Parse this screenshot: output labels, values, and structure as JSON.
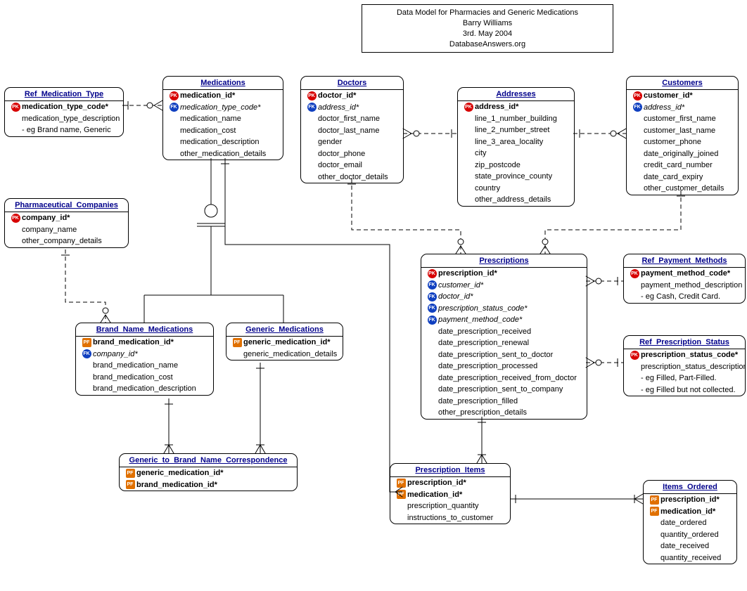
{
  "title": {
    "line1": "Data Model for Pharmacies and Generic Medications",
    "line2": "Barry Williams",
    "line3": "3rd. May 2004",
    "line4": "DatabaseAnswers.org"
  },
  "entities": {
    "ref_medication_type": {
      "name": "Ref_Medication_Type",
      "rows": [
        {
          "k": "pk",
          "t": "medication_type_code*",
          "cls": "attr-pk"
        },
        {
          "k": "",
          "t": "medication_type_description"
        },
        {
          "k": "",
          "t": "- eg Brand name, Generic"
        }
      ]
    },
    "medications": {
      "name": "Medications",
      "rows": [
        {
          "k": "pk",
          "t": "medication_id*",
          "cls": "attr-pk"
        },
        {
          "k": "fk",
          "t": "medication_type_code*",
          "cls": "attr-fk"
        },
        {
          "k": "",
          "t": "medication_name"
        },
        {
          "k": "",
          "t": "medication_cost"
        },
        {
          "k": "",
          "t": "medication_description"
        },
        {
          "k": "",
          "t": "other_medication_details"
        }
      ]
    },
    "doctors": {
      "name": "Doctors",
      "rows": [
        {
          "k": "pk",
          "t": "doctor_id*",
          "cls": "attr-pk"
        },
        {
          "k": "fk",
          "t": "address_id*",
          "cls": "attr-fk"
        },
        {
          "k": "",
          "t": "doctor_first_name"
        },
        {
          "k": "",
          "t": "doctor_last_name"
        },
        {
          "k": "",
          "t": "gender"
        },
        {
          "k": "",
          "t": "doctor_phone"
        },
        {
          "k": "",
          "t": "doctor_email"
        },
        {
          "k": "",
          "t": "other_doctor_details"
        }
      ]
    },
    "addresses": {
      "name": "Addresses",
      "rows": [
        {
          "k": "pk",
          "t": "address_id*",
          "cls": "attr-pk"
        },
        {
          "k": "",
          "t": "line_1_number_building"
        },
        {
          "k": "",
          "t": "line_2_number_street"
        },
        {
          "k": "",
          "t": "line_3_area_locality"
        },
        {
          "k": "",
          "t": "city"
        },
        {
          "k": "",
          "t": "zip_postcode"
        },
        {
          "k": "",
          "t": "state_province_county"
        },
        {
          "k": "",
          "t": "country"
        },
        {
          "k": "",
          "t": "other_address_details"
        }
      ]
    },
    "customers": {
      "name": "Customers",
      "rows": [
        {
          "k": "pk",
          "t": "customer_id*",
          "cls": "attr-pk"
        },
        {
          "k": "fk",
          "t": "address_id*",
          "cls": "attr-fk"
        },
        {
          "k": "",
          "t": "customer_first_name"
        },
        {
          "k": "",
          "t": "customer_last_name"
        },
        {
          "k": "",
          "t": "customer_phone"
        },
        {
          "k": "",
          "t": "date_originally_joined"
        },
        {
          "k": "",
          "t": "credit_card_number"
        },
        {
          "k": "",
          "t": "date_card_expiry"
        },
        {
          "k": "",
          "t": "other_customer_details"
        }
      ]
    },
    "pharma_companies": {
      "name": "Pharmaceutical_Companies",
      "rows": [
        {
          "k": "pk",
          "t": "company_id*",
          "cls": "attr-pk"
        },
        {
          "k": "",
          "t": "company_name"
        },
        {
          "k": "",
          "t": "other_company_details"
        }
      ]
    },
    "prescriptions": {
      "name": "Prescriptions",
      "rows": [
        {
          "k": "pk",
          "t": "prescription_id*",
          "cls": "attr-pk"
        },
        {
          "k": "fk",
          "t": "customer_id*",
          "cls": "attr-fk"
        },
        {
          "k": "fk",
          "t": "doctor_id*",
          "cls": "attr-fk"
        },
        {
          "k": "fk",
          "t": "prescription_status_code*",
          "cls": "attr-fk"
        },
        {
          "k": "fk",
          "t": "payment_method_code*",
          "cls": "attr-fk"
        },
        {
          "k": "",
          "t": "date_prescription_received"
        },
        {
          "k": "",
          "t": "date_prescription_renewal"
        },
        {
          "k": "",
          "t": "date_prescription_sent_to_doctor"
        },
        {
          "k": "",
          "t": "date_prescription_processed"
        },
        {
          "k": "",
          "t": "date_prescription_received_from_doctor"
        },
        {
          "k": "",
          "t": "date_prescription_sent_to_company"
        },
        {
          "k": "",
          "t": "date_prescription_filled"
        },
        {
          "k": "",
          "t": "other_prescription_details"
        }
      ]
    },
    "ref_payment_methods": {
      "name": "Ref_Payment_Methods",
      "rows": [
        {
          "k": "pk",
          "t": "payment_method_code*",
          "cls": "attr-pk"
        },
        {
          "k": "",
          "t": "payment_method_description"
        },
        {
          "k": "",
          "t": "- eg Cash, Credit Card."
        }
      ]
    },
    "ref_prescription_status": {
      "name": "Ref_Prescription_Status",
      "rows": [
        {
          "k": "pk",
          "t": "prescription_status_code*",
          "cls": "attr-pk"
        },
        {
          "k": "",
          "t": "prescription_status_description"
        },
        {
          "k": "",
          "t": "- eg Filled, Part-Filled."
        },
        {
          "k": "",
          "t": "- eg Filled but not collected."
        }
      ]
    },
    "brand_name_medications": {
      "name": "Brand_Name_Medications",
      "rows": [
        {
          "k": "pf",
          "t": "brand_medication_id*",
          "cls": "attr-pk"
        },
        {
          "k": "fk",
          "t": "company_id*",
          "cls": "attr-fk"
        },
        {
          "k": "",
          "t": "brand_medication_name"
        },
        {
          "k": "",
          "t": "brand_medication_cost"
        },
        {
          "k": "",
          "t": "brand_medication_description"
        }
      ]
    },
    "generic_medications": {
      "name": "Generic_Medications",
      "rows": [
        {
          "k": "pf",
          "t": "generic_medication_id*",
          "cls": "attr-pk"
        },
        {
          "k": "",
          "t": "generic_medication_details"
        }
      ]
    },
    "generic_to_brand": {
      "name": "Generic_to_Brand_Name_Correspondence",
      "rows": [
        {
          "k": "pf",
          "t": "generic_medication_id*",
          "cls": "attr-pk"
        },
        {
          "k": "pf",
          "t": "brand_medication_id*",
          "cls": "attr-pk"
        }
      ]
    },
    "prescription_items": {
      "name": "Prescription_Items",
      "rows": [
        {
          "k": "pf",
          "t": "prescription_id*",
          "cls": "attr-pk"
        },
        {
          "k": "pf",
          "t": "medication_id*",
          "cls": "attr-pk"
        },
        {
          "k": "",
          "t": "prescription_quantity"
        },
        {
          "k": "",
          "t": "instructions_to_customer"
        }
      ]
    },
    "items_ordered": {
      "name": "Items_Ordered",
      "rows": [
        {
          "k": "pf",
          "t": "prescription_id*",
          "cls": "attr-pk"
        },
        {
          "k": "pf",
          "t": "medication_id*",
          "cls": "attr-pk"
        },
        {
          "k": "",
          "t": "date_ordered"
        },
        {
          "k": "",
          "t": "quantity_ordered"
        },
        {
          "k": "",
          "t": "date_received"
        },
        {
          "k": "",
          "t": "quantity_received"
        }
      ]
    }
  }
}
